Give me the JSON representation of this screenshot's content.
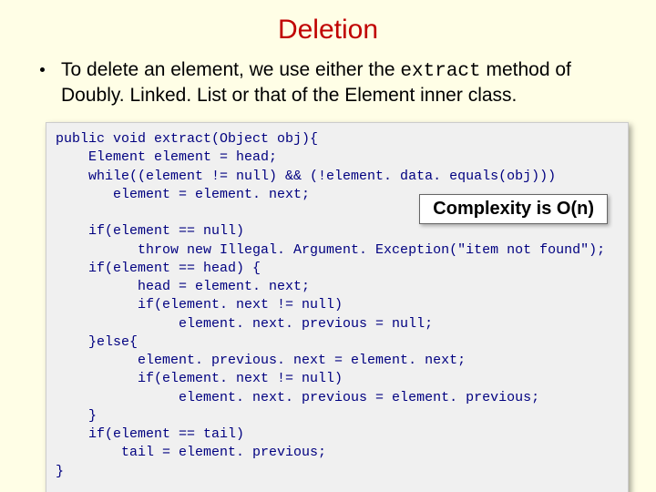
{
  "title": "Deletion",
  "bullet": {
    "pre": "To delete an element, we use either the ",
    "mono": "extract",
    "post": " method of Doubly. Linked. List or that of the Element inner class."
  },
  "complexity": "Complexity is O(n)",
  "code": "public void extract(Object obj){\n    Element element = head;\n    while((element != null) && (!element. data. equals(obj)))\n       element = element. next;\n\n    if(element == null)\n          throw new Illegal. Argument. Exception(\"item not found\");\n    if(element == head) {\n          head = element. next;\n          if(element. next != null)\n               element. next. previous = null;\n    }else{\n          element. previous. next = element. next;\n          if(element. next != null)\n               element. next. previous = element. previous;\n    }\n    if(element == tail)\n        tail = element. previous;\n}"
}
